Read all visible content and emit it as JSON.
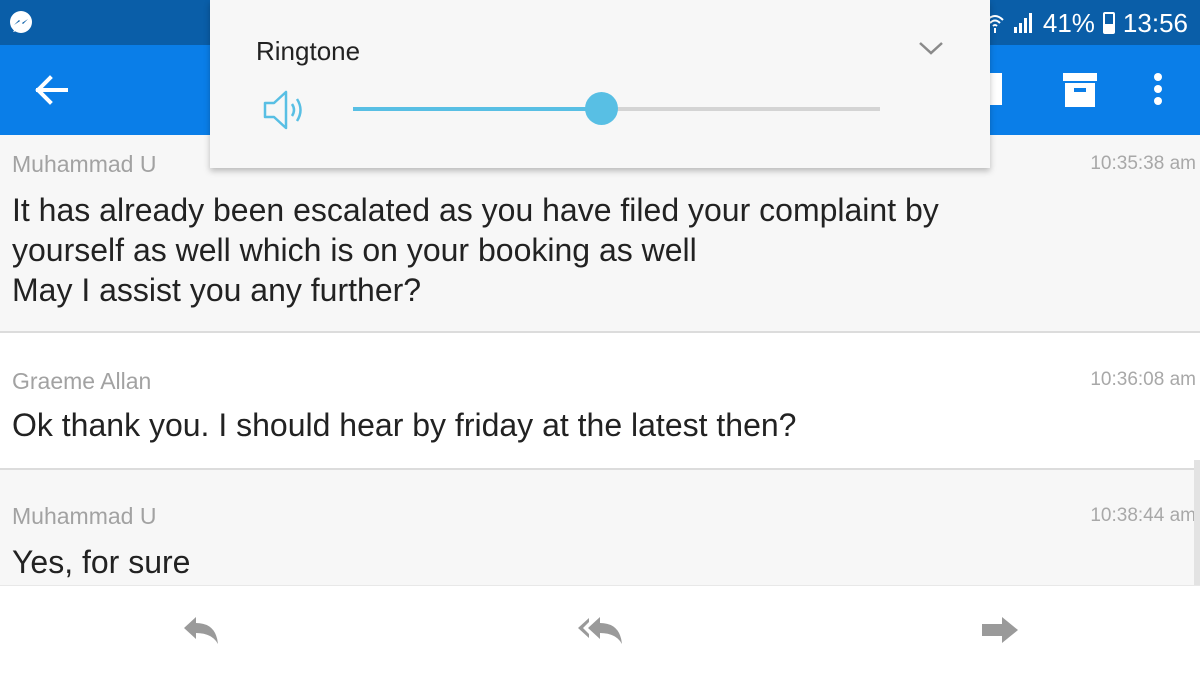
{
  "status_bar": {
    "battery": "41%",
    "time": "13:56",
    "icons": [
      "messenger-icon",
      "wifi-icon",
      "signal-icon",
      "battery-icon"
    ]
  },
  "app_bar": {
    "icons": [
      "back-arrow-icon",
      "delete-icon",
      "archive-icon",
      "more-vert-icon"
    ]
  },
  "volume_panel": {
    "title": "Ringtone",
    "level": 0.47,
    "accent": "#58bfe4"
  },
  "messages": [
    {
      "sender": "Muhammad U",
      "time": "10:35:38 am",
      "body": "It has already been escalated as you have filed your complaint by\nyourself as well which is on your booking as well\nMay I assist you any further?"
    },
    {
      "sender": "Graeme Allan",
      "time": "10:36:08 am",
      "body": "Ok thank you. I should hear by friday at the latest then?"
    },
    {
      "sender": "Muhammad U",
      "time": "10:38:44 am",
      "body": "Yes, for sure"
    }
  ],
  "bottom_bar": {
    "icons": [
      "reply-icon",
      "reply-all-icon",
      "forward-icon"
    ]
  },
  "colors": {
    "status_bar": "#0a5ea8",
    "app_bar": "#0a7ee8",
    "icon_grey": "#9a9a9a"
  }
}
